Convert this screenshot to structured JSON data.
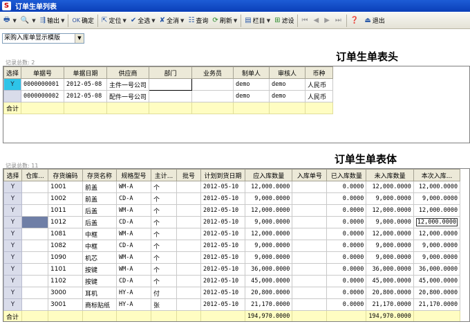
{
  "window": {
    "title": "订单生单列表"
  },
  "toolbar": {
    "print": "",
    "preview": "",
    "export": "输出",
    "ok": "OK",
    "confirm": "确定",
    "locate": "定位",
    "select_all": "全选",
    "deselect_all": "全消",
    "query": "查询",
    "refresh": "刷新",
    "columns": "栏目",
    "filter": "滤设",
    "exit": "退出"
  },
  "template_select": {
    "value": "采购入库单显示模版"
  },
  "header_section": {
    "title": "订单生单表头",
    "record_count": "记录总数: 2",
    "columns": [
      "选择",
      "单据号",
      "单据日期",
      "供应商",
      "部门",
      "业务员",
      "制单人",
      "审核人",
      "币种"
    ],
    "rows": [
      {
        "select": "Y",
        "doc_no": "0000000001",
        "date": "2012-05-08",
        "supplier": "主件一号公司",
        "dept": "",
        "clerk": "",
        "maker": "demo",
        "auditor": "demo",
        "currency": "人民币"
      },
      {
        "select": "",
        "doc_no": "0000000002",
        "date": "2012-05-08",
        "supplier": "配件一号公司",
        "dept": "",
        "clerk": "",
        "maker": "demo",
        "auditor": "demo",
        "currency": "人民币"
      }
    ],
    "total_label": "合计"
  },
  "body_section": {
    "title": "订单生单表体",
    "record_count": "记录总数: 11",
    "columns": [
      "选择",
      "仓库...",
      "存货编码",
      "存货名称",
      "规格型号",
      "主计...",
      "批号",
      "计划到货日期",
      "应入库数量",
      "入库单号",
      "已入库数量",
      "未入库数量",
      "本次入库..."
    ],
    "rows": [
      {
        "select": "Y",
        "code": "1001",
        "name": "前盖",
        "spec": "WM-A",
        "unit": "个",
        "batch": "",
        "plan_date": "2012-05-10",
        "qty_due": "12,000.0000",
        "in_no": "",
        "qty_in": "0.0000",
        "qty_left": "12,000.0000",
        "qty_now": "12,000.0000"
      },
      {
        "select": "Y",
        "code": "1002",
        "name": "前盖",
        "spec": "CD-A",
        "unit": "个",
        "batch": "",
        "plan_date": "2012-05-10",
        "qty_due": "9,000.0000",
        "in_no": "",
        "qty_in": "0.0000",
        "qty_left": "9,000.0000",
        "qty_now": "9,000.0000"
      },
      {
        "select": "Y",
        "code": "1011",
        "name": "后盖",
        "spec": "WM-A",
        "unit": "个",
        "batch": "",
        "plan_date": "2012-05-10",
        "qty_due": "12,000.0000",
        "in_no": "",
        "qty_in": "0.0000",
        "qty_left": "12,000.0000",
        "qty_now": "12,000.0000"
      },
      {
        "select": "Y",
        "code": "1012",
        "name": "后盖",
        "spec": "CD-A",
        "unit": "个",
        "batch": "",
        "plan_date": "2012-05-10",
        "qty_due": "9,000.0000",
        "in_no": "",
        "qty_in": "0.0000",
        "qty_left": "9,000.0000",
        "qty_now": "12,000.0000"
      },
      {
        "select": "Y",
        "code": "1081",
        "name": "中框",
        "spec": "WM-A",
        "unit": "个",
        "batch": "",
        "plan_date": "2012-05-10",
        "qty_due": "12,000.0000",
        "in_no": "",
        "qty_in": "0.0000",
        "qty_left": "12,000.0000",
        "qty_now": "12,000.0000"
      },
      {
        "select": "Y",
        "code": "1082",
        "name": "中框",
        "spec": "CD-A",
        "unit": "个",
        "batch": "",
        "plan_date": "2012-05-10",
        "qty_due": "9,000.0000",
        "in_no": "",
        "qty_in": "0.0000",
        "qty_left": "9,000.0000",
        "qty_now": "9,000.0000"
      },
      {
        "select": "Y",
        "code": "1090",
        "name": "机芯",
        "spec": "WM-A",
        "unit": "个",
        "batch": "",
        "plan_date": "2012-05-10",
        "qty_due": "9,000.0000",
        "in_no": "",
        "qty_in": "0.0000",
        "qty_left": "9,000.0000",
        "qty_now": "9,000.0000"
      },
      {
        "select": "Y",
        "code": "1101",
        "name": "按键",
        "spec": "WM-A",
        "unit": "个",
        "batch": "",
        "plan_date": "2012-05-10",
        "qty_due": "36,000.0000",
        "in_no": "",
        "qty_in": "0.0000",
        "qty_left": "36,000.0000",
        "qty_now": "36,000.0000"
      },
      {
        "select": "Y",
        "code": "1102",
        "name": "按键",
        "spec": "CD-A",
        "unit": "个",
        "batch": "",
        "plan_date": "2012-05-10",
        "qty_due": "45,000.0000",
        "in_no": "",
        "qty_in": "0.0000",
        "qty_left": "45,000.0000",
        "qty_now": "45,000.0000"
      },
      {
        "select": "Y",
        "code": "3000",
        "name": "耳机",
        "spec": "HY-A",
        "unit": "付",
        "batch": "",
        "plan_date": "2012-05-10",
        "qty_due": "20,800.0000",
        "in_no": "",
        "qty_in": "0.0000",
        "qty_left": "20,800.0000",
        "qty_now": "20,800.0000"
      },
      {
        "select": "Y",
        "code": "3001",
        "name": "商标贴纸",
        "spec": "HY-A",
        "unit": "张",
        "batch": "",
        "plan_date": "2012-05-10",
        "qty_due": "21,170.0000",
        "in_no": "",
        "qty_in": "0.0000",
        "qty_left": "21,170.0000",
        "qty_now": "21,170.0000"
      }
    ],
    "total_label": "合计",
    "total_qty_due": "194,970.0000",
    "total_qty_left": "194,970.0000"
  }
}
